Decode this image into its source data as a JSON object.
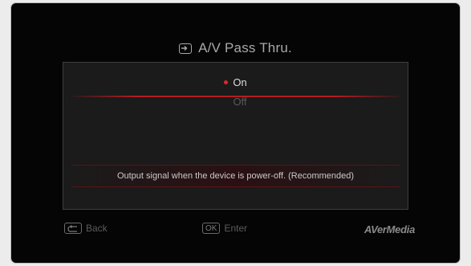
{
  "window": {
    "title": "A/V Pass Thru.",
    "title_icon": "av-input-icon"
  },
  "options": [
    {
      "label": "On",
      "selected": true
    },
    {
      "label": "Off",
      "selected": false
    }
  ],
  "description": "Output signal when the device is power-off. (Recommended)",
  "footer": {
    "back_label": "Back",
    "back_icon": "back-arrow-icon",
    "enter_key": "OK",
    "enter_label": "Enter",
    "brand": "AVerMedia"
  },
  "colors": {
    "accent": "#e0262b",
    "background": "#050505",
    "panel": "#1b1b1b"
  }
}
